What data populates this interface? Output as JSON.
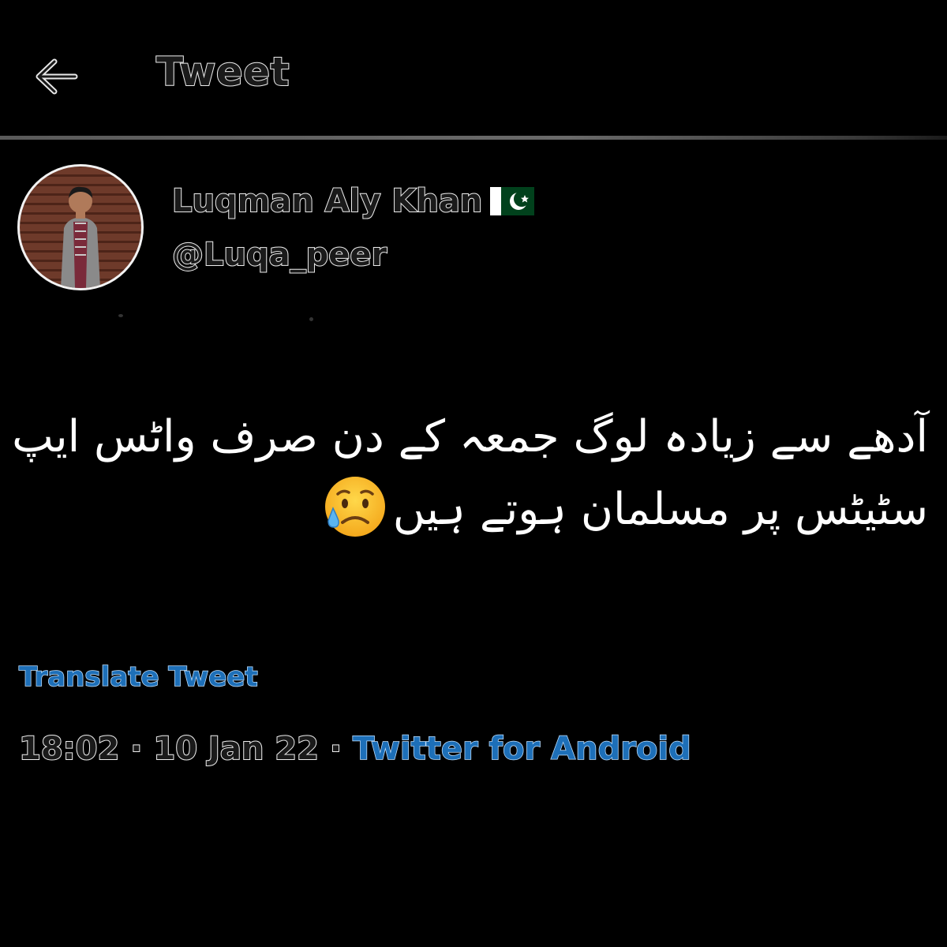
{
  "header": {
    "back_icon": "arrow-left-icon",
    "title": "Tweet"
  },
  "author": {
    "display_name": "Luqman Aly Khan",
    "flag_icon": "pakistan-flag-icon",
    "handle": "@Luqa_peer"
  },
  "tweet": {
    "lines": [
      "آدھے سے زیادہ لوگ جمعہ کے دن صرف واٹس ایپ",
      "سٹیٹس پر مسلمان ہوتے ہیں"
    ],
    "emoji_icon": "sad-but-relieved-face-icon"
  },
  "translate_label": "Translate Tweet",
  "meta": {
    "time": "18:02",
    "separator": "·",
    "date": "10 Jan 22",
    "source": "Twitter for Android"
  },
  "colors": {
    "background": "#000000",
    "link": "#1d9bf0",
    "text": "#ffffff"
  }
}
